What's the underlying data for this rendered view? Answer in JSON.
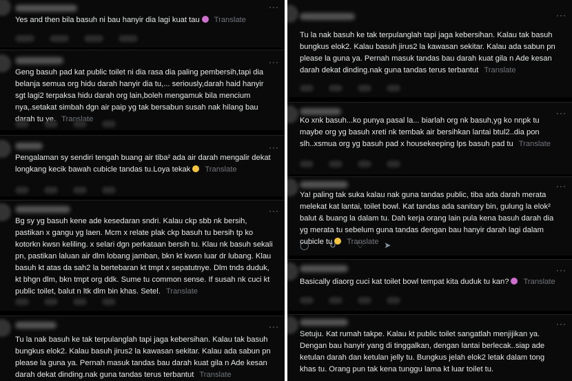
{
  "left": {
    "posts": [
      {
        "text": "Yes and then bila basuh ni bau hanyir dia lagi kuat tau"
      },
      {
        "text": "Geng basuh pad kat public toilet ni dia rasa dia paling pembersih,tapi dia belanja semua org hidu darah hanyir dia tu,... seriously,darah haid hanyir sgt lagi2 terpaksa hidu darah org lain,boleh mengamuk bila mencium nya,.setakat simbah dgn air paip yg tak bersabun susah nak hilang bau darah tu ye."
      },
      {
        "text": "Pengalaman sy sendiri tengah buang air tiba² ada air darah mengalir dekat longkang kecik bawah cubicle tandas tu.Loya tekak"
      },
      {
        "text": "Bg sy yg basuh kene ade kesedaran sndri. Kalau ckp sbb nk bersih, pastikan x gangu yg laen. Mcm x relate plak ckp basuh tu bersih tp ko kotorkn kwsn keliling. x selari dgn perkataan bersih tu. Klau nk basuh sekali pn, pastikan laluan air dlm lobang jamban, bkn kt kwsn luar dr lubang. Klau basuh kt atas da sah2 la bertebaran kt tmpt x sepatutnye. Dlm tnds duduk, kt bhgn dlm, bkn tmpt org ddk. Sume tu common sense. If susah nk cuci kt public toilet, balut n ltk dlm bin khas. Setel."
      },
      {
        "text": "Tu la nak basuh ke tak terpulanglah tapi jaga kebersihan. Kalau tak basuh bungkus elok2. Kalau basuh jirus2 la kawasan sekitar. Kalau ada sabun pn please la guna ya. Pernah masuk tandas bau darah kuat gila n Ade kesan darah dekat dinding.nak guna tandas terus terbantut"
      }
    ]
  },
  "right": {
    "posts": [
      {
        "text": "Tu la nak basuh ke tak terpulanglah tapi jaga kebersihan. Kalau tak basuh bungkus elok2. Kalau basuh jirus2 la kawasan sekitar. Kalau ada sabun pn please la guna ya. Pernah masuk tandas bau darah kuat gila n Ade kesan darah dekat dinding.nak guna tandas terus terbantut"
      },
      {
        "text": "Ko xnk basuh...ko punya pasal la... biarlah org nk basuh,yg ko nnpk tu maybe org yg basuh xreti nk tembak air bersihkan lantai btul2..dia pon slh..xsmua org yg basuh pad x housekeeping lps basuh pad tu"
      },
      {
        "text": "Ya! paling tak suka kalau nak guna tandas public, tiba ada darah merata melekat kat lantai, toilet bowl. Kat tandas ada sanitary bin, gulung la elok² balut & buang la dalam tu. Dah kerja orang lain pula kena basuh darah dia yg merata tu sebelum guna tandas dengan bau hanyir darah lagi dalam cubicle tu"
      },
      {
        "text": "Basically diaorg cuci kat toilet bowl tempat kita duduk tu kan?"
      },
      {
        "text": "Setuju. Kat rumah takpe. Kalau kt public toilet sangatlah menjijikan ya. Dengan bau hanyir yang di tinggalkan, dengan lantai berlecak..siap ade ketulan darah dan ketulan jelly tu. Bungkus jelah elok2 letak dalam tong khas tu. Orang pun tak kena tunggu lama kt luar toilet tu."
      }
    ]
  },
  "translate_label": "Translate",
  "more_label": "···",
  "icons": [
    "reply-icon",
    "retweet-icon",
    "like-icon",
    "share-icon"
  ]
}
